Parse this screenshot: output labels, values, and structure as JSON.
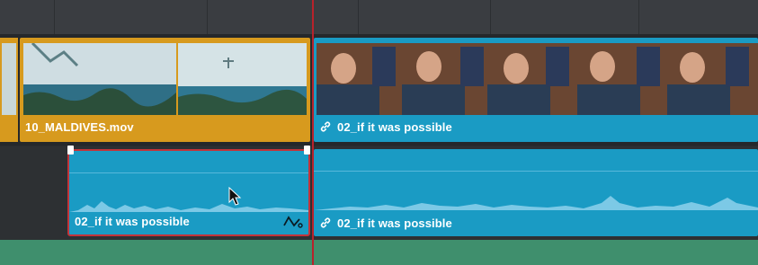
{
  "timeline": {
    "video_track": {
      "clips": [
        {
          "name": "10_MALDIVES.mov",
          "linked": false,
          "color": "#d79a1e"
        },
        {
          "name": "02_if it was possible",
          "linked": true,
          "color": "#1a9bc4"
        }
      ]
    },
    "audio_track": {
      "clips": [
        {
          "name": "02_if it was possible",
          "linked": false,
          "selected": true,
          "color": "#1a9bc4"
        },
        {
          "name": "02_if it was possible",
          "linked": true,
          "color": "#1a9bc4"
        }
      ]
    }
  },
  "colors": {
    "selection_outline": "#c2343a",
    "playhead": "#b8222b",
    "waveform": "#7cc9e6"
  },
  "icons": [
    "link-icon",
    "curve-icon",
    "pointer-cursor-icon"
  ]
}
